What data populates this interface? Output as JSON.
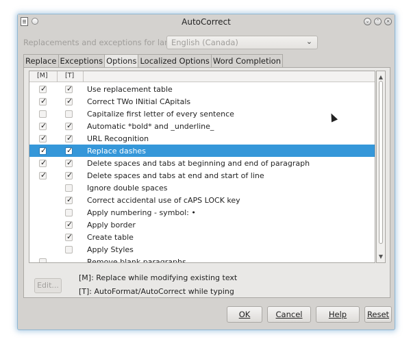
{
  "window": {
    "title": "AutoCorrect",
    "app_icon": "document-icon",
    "controls": [
      "minimize-icon",
      "maximize-icon",
      "close-icon"
    ]
  },
  "language": {
    "label": "Replacements and exceptions for language:",
    "selected": "English (Canada)"
  },
  "tabs": [
    {
      "label": "Replace",
      "active": false
    },
    {
      "label": "Exceptions",
      "active": false
    },
    {
      "label": "Options",
      "active": true
    },
    {
      "label": "Localized Options",
      "active": false
    },
    {
      "label": "Word Completion",
      "active": false
    }
  ],
  "options": {
    "col_m": "[M]",
    "col_t": "[T]",
    "items": [
      {
        "label": "Use replacement table",
        "m": true,
        "t": true
      },
      {
        "label": "Correct TWo INitial CApitals",
        "m": true,
        "t": true
      },
      {
        "label": "Capitalize first letter of every sentence",
        "m": false,
        "t": false
      },
      {
        "label": "Automatic *bold* and _underline_",
        "m": true,
        "t": true
      },
      {
        "label": "URL Recognition",
        "m": true,
        "t": true
      },
      {
        "label": "Replace dashes",
        "m": true,
        "t": true,
        "selected": true
      },
      {
        "label": "Delete spaces and tabs at beginning and end of paragraph",
        "m": true,
        "t": true
      },
      {
        "label": "Delete spaces and tabs at end and start of line",
        "m": true,
        "t": true
      },
      {
        "label": "Ignore double spaces",
        "t": false
      },
      {
        "label": "Correct accidental use of cAPS LOCK key",
        "t": true
      },
      {
        "label": "Apply numbering - symbol: •",
        "t": false
      },
      {
        "label": "Apply border",
        "t": true
      },
      {
        "label": "Create table",
        "t": true
      },
      {
        "label": "Apply Styles",
        "t": false
      },
      {
        "label": "Remove blank paragraphs",
        "m": false
      }
    ]
  },
  "edit_button": {
    "label": "Edit..."
  },
  "legend": {
    "m": "[M]: Replace while modifying existing text",
    "t": "[T]: AutoFormat/AutoCorrect while typing"
  },
  "buttons": {
    "ok": "OK",
    "cancel": "Cancel",
    "help": "Help",
    "reset": "Reset"
  },
  "colors": {
    "selection": "#3597d9",
    "dialog_bg": "#d4d2cf",
    "glow": "#8fb7d3"
  }
}
